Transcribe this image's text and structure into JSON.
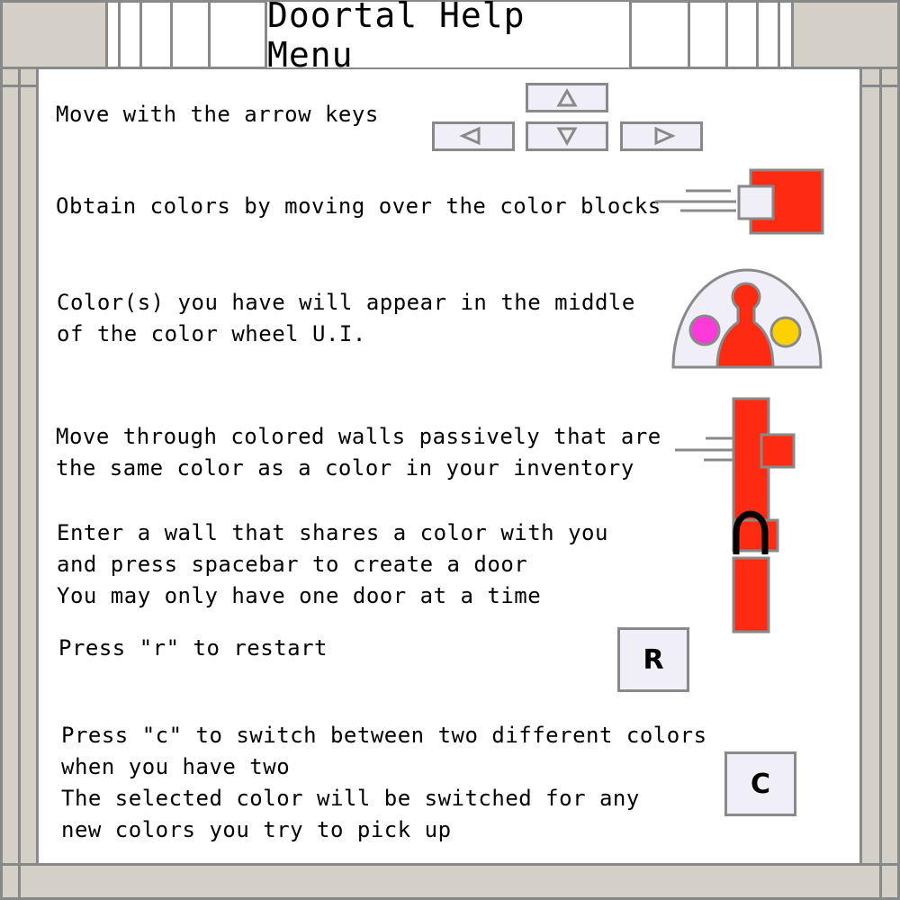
{
  "title": "Doortal Help Menu",
  "colors": {
    "frame": "#888a89",
    "background": "#d4d0c8",
    "panel": "#ffffff",
    "key_fill": "#f0eef6",
    "red": "#ff2a12",
    "magenta": "#ff3ad8",
    "yellow": "#ffd000"
  },
  "instructions": {
    "move": "Move with the arrow keys",
    "obtain": "Obtain colors by moving over the color blocks",
    "wheel_line1": "Color(s) you have will appear in the middle",
    "wheel_line2": "of the color wheel U.I.",
    "walls_line1": "Move through colored walls passively that are",
    "walls_line2": "the same color as a color in your inventory",
    "door_line1": "Enter a wall that shares a color with you",
    "door_line2": "and press spacebar to create a door",
    "door_line3": "You may only have one door at a time",
    "restart": "Press \"r\" to restart",
    "switch_line1": "Press \"c\" to switch between two different colors",
    "switch_line2": "when you have two",
    "switch_line3": "The selected color will be switched for any",
    "switch_line4": "new colors you try to pick up"
  },
  "keys": {
    "restart_key": "R",
    "switch_key": "C"
  },
  "icons": {
    "arrow_up": "triangle-up-icon",
    "arrow_down": "triangle-down-icon",
    "arrow_left": "triangle-left-icon",
    "arrow_right": "triangle-right-icon"
  }
}
